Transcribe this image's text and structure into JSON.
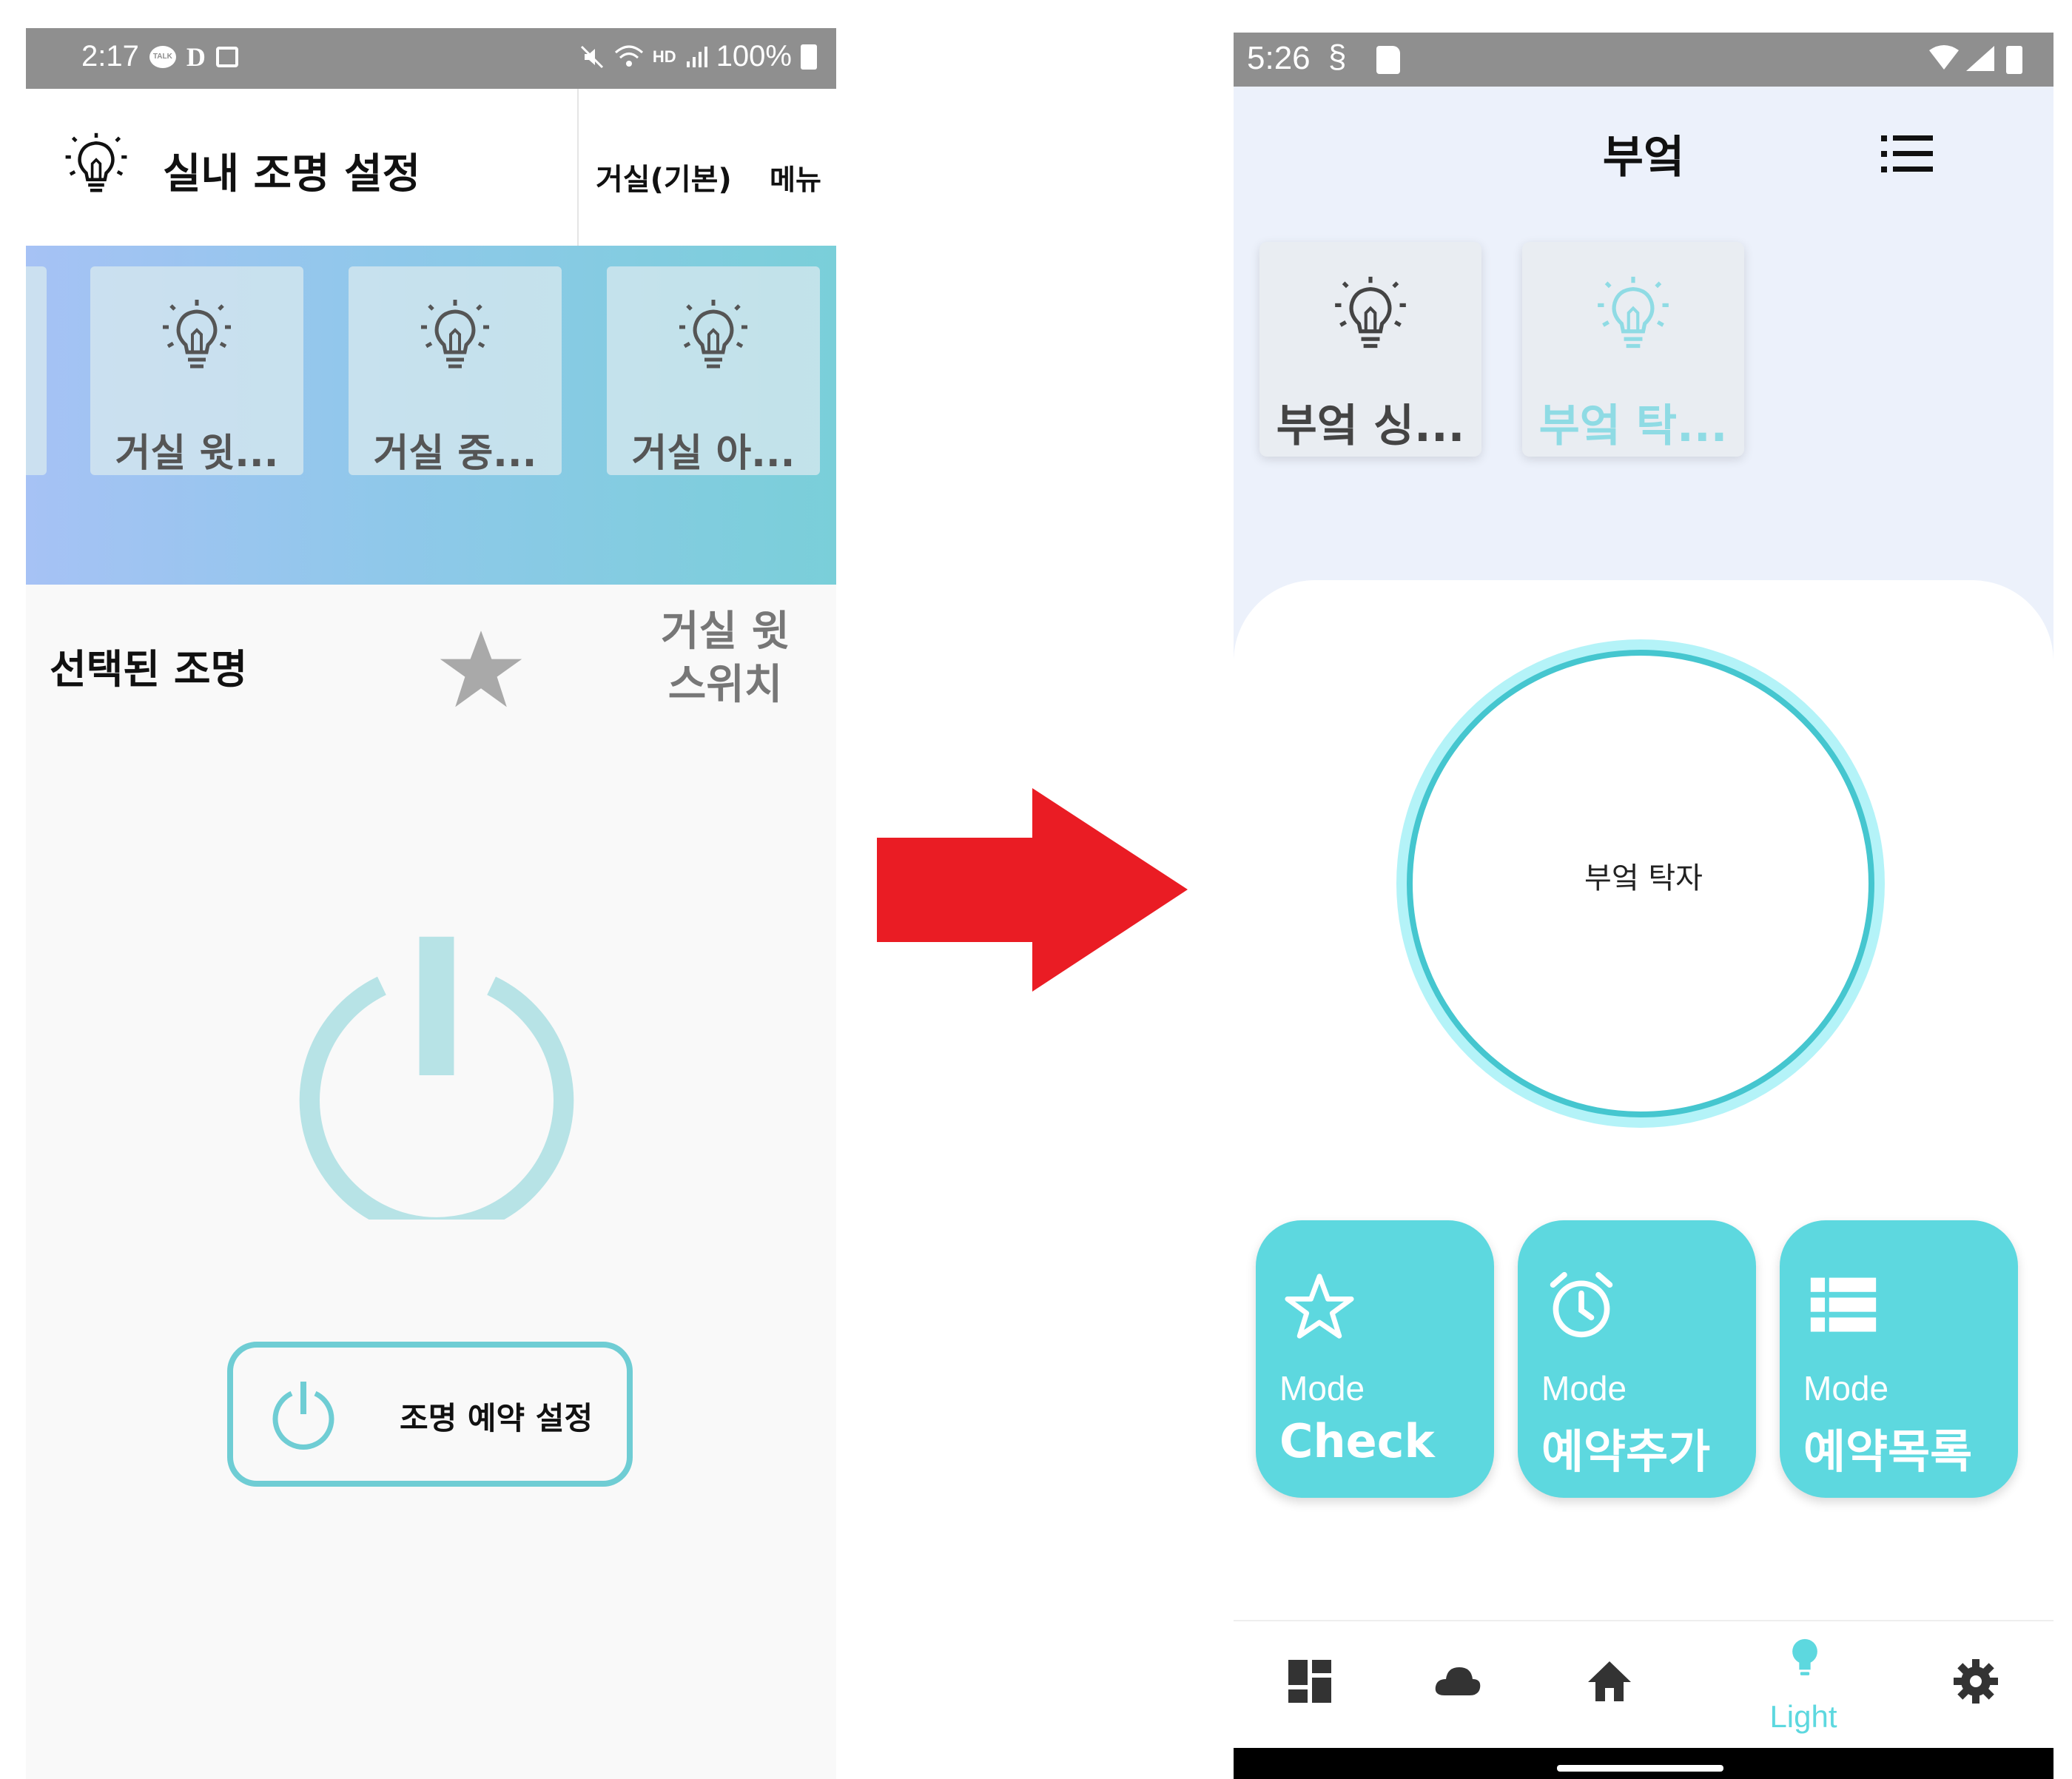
{
  "left_phone": {
    "status": {
      "time": "2:17",
      "talk_badge": "TALK",
      "d_char": "D",
      "hd": "HD",
      "battery": "100%"
    },
    "header": {
      "title": "실내 조명 설정",
      "room": "거실(기본)",
      "menu": "메뉴",
      "icon": "bulb-icon"
    },
    "light_cards": [
      {
        "label": "거실 윗..."
      },
      {
        "label": "거실 중..."
      },
      {
        "label": "거실 아..."
      }
    ],
    "selected": {
      "label": "선택된 조명",
      "name_line1": "거실 윗",
      "name_line2": "스위치",
      "star_icon": "star-icon"
    },
    "reserve_button": {
      "label": "조명 예약 설정",
      "icon": "power-icon"
    },
    "colors": {
      "accent": "#6fcdd4",
      "status_bar": "#8f8f8f"
    }
  },
  "arrow": {
    "color": "#ea1c24",
    "icon": "right-arrow-icon"
  },
  "right_phone": {
    "status": {
      "time": "5:26"
    },
    "header": {
      "title": "부엌",
      "menu_icon": "list-icon"
    },
    "light_cards": [
      {
        "label": "부엌 싱...",
        "state": "normal"
      },
      {
        "label": "부엌 탁...",
        "state": "selected"
      }
    ],
    "selected_light": "부엌 탁자",
    "mode_buttons": [
      {
        "line1": "Mode",
        "line2": "Check",
        "icon": "star-outline-icon"
      },
      {
        "line1": "Mode",
        "line2": "예약추가",
        "icon": "alarm-icon"
      },
      {
        "line1": "Mode",
        "line2": "예약목록",
        "icon": "list-icon"
      }
    ],
    "nav": [
      {
        "name": "dashboard",
        "icon": "dashboard-icon"
      },
      {
        "name": "cloud",
        "icon": "cloud-icon"
      },
      {
        "name": "home",
        "icon": "home-icon"
      },
      {
        "name": "light",
        "label": "Light",
        "icon": "bulb-icon",
        "active": true
      },
      {
        "name": "settings",
        "icon": "gear-icon"
      }
    ],
    "colors": {
      "accent": "#5dd8df",
      "ring": "#45c6cf",
      "background": "#ecf1fb"
    }
  }
}
